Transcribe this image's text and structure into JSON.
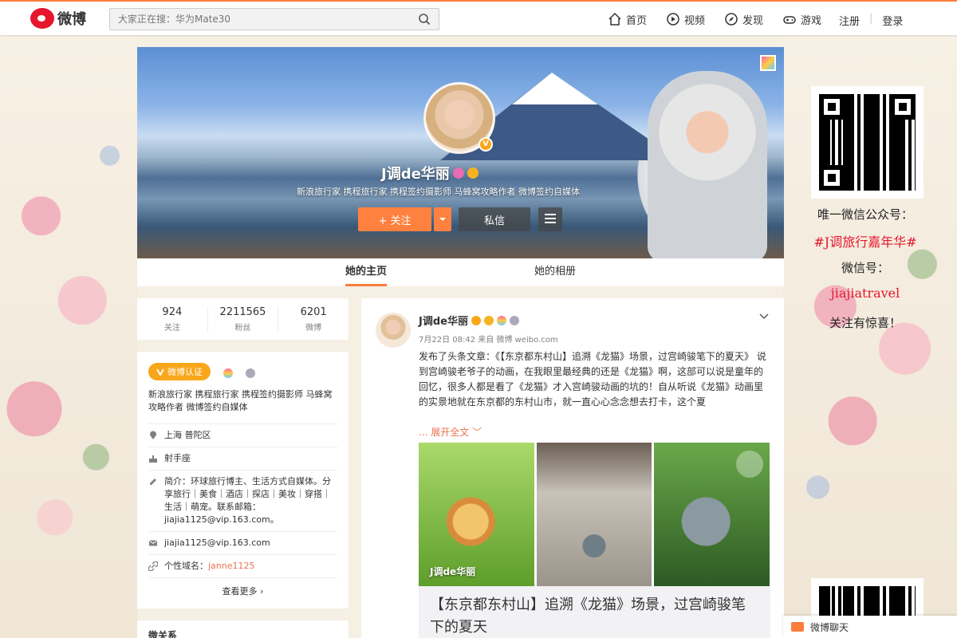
{
  "topbar": {
    "logo_text": "微博",
    "search_placeholder": "大家正在搜：华为Mate30",
    "nav": [
      {
        "label": "首页",
        "icon": "home-icon"
      },
      {
        "label": "视频",
        "icon": "video-icon"
      },
      {
        "label": "发现",
        "icon": "compass-icon"
      },
      {
        "label": "游戏",
        "icon": "gamepad-icon"
      }
    ],
    "register": "注册",
    "login": "登录"
  },
  "profile": {
    "name": "J调de华丽",
    "verified": "V",
    "description": "新浪旅行家 携程旅行家 携程签约摄影师 马蜂窝攻略作者 微博签约自媒体",
    "follow_label": "+ 关注",
    "message_label": "私信"
  },
  "tabs": [
    {
      "label": "她的主页",
      "active": true
    },
    {
      "label": "她的相册",
      "active": false
    }
  ],
  "stats": [
    {
      "num": "924",
      "label": "关注"
    },
    {
      "num": "2211565",
      "label": "粉丝"
    },
    {
      "num": "6201",
      "label": "微博"
    }
  ],
  "info": {
    "badge_label": "微博认证",
    "desc": "新浪旅行家 携程旅行家 携程签约摄影师 马蜂窝攻略作者 微博签约自媒体",
    "location": "上海 普陀区",
    "zodiac": "射手座",
    "bio": "简介：环球旅行博主、生活方式自媒体。分享旅行｜美食｜酒店｜探店｜美妆｜穿搭｜生活｜萌宠。联系邮箱：jiajia1125@vip.163.com。",
    "email": "jiajia1125@vip.163.com",
    "domain_label": "个性域名：",
    "domain_value": "janne1125",
    "see_more": "查看更多 ›"
  },
  "wei_relation": "微关系",
  "post": {
    "author": "J调de华丽",
    "meta": "7月22日 08:42 来自 微博 weibo.com",
    "text": "发布了头条文章：《【东京都东村山】追溯《龙猫》场景，过宫崎骏笔下的夏天》 说到宫崎骏老爷子的动画，在我眼里最经典的还是《龙猫》啊，这部可以说是童年的回忆，很多人都是看了《龙猫》才入宫崎骏动画的坑的！自从听说《龙猫》动画里的实景地就在东京都的东村山市，就一直心心念念想去打卡，这个夏",
    "expand": "... 展开全文 ﹀",
    "photo_caption": "J调de华丽",
    "article_title": "【东京都东村山】追溯《龙猫》场景，过宫崎骏笔下的夏天"
  },
  "wechat": {
    "line1": "唯一微信公众号：",
    "line2": "#J调旅行嘉年华#",
    "line3": "微信号：",
    "line4": "jiajiatravel",
    "line5": "关注有惊喜！"
  },
  "chat": {
    "label": "微博聊天"
  },
  "colors": {
    "accent": "#fa7d3c",
    "follow": "#ff8140",
    "link": "#eb7350",
    "verified": "#f9a61a"
  }
}
